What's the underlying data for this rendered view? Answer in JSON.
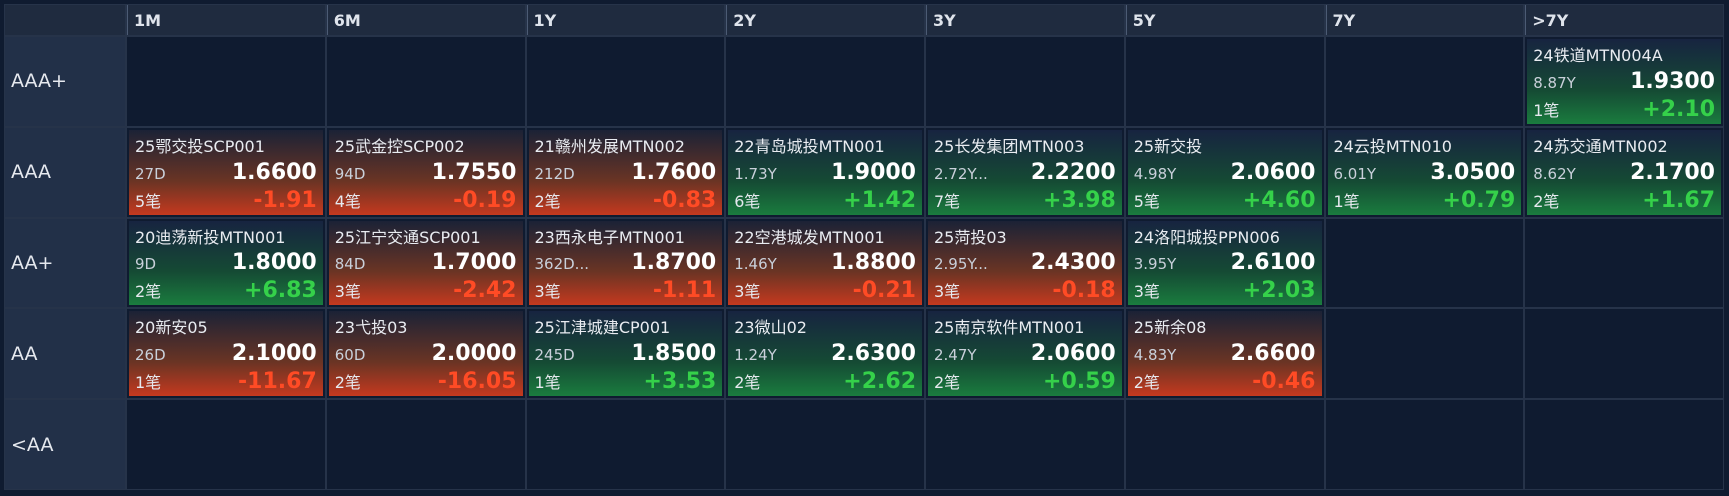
{
  "columns": [
    "1M",
    "6M",
    "1Y",
    "2Y",
    "3Y",
    "5Y",
    "7Y",
    ">7Y"
  ],
  "rows": [
    {
      "label": "AAA+",
      "cells": [
        null,
        null,
        null,
        null,
        null,
        null,
        null,
        {
          "name": "24铁道MTN004A",
          "term": "8.87Y",
          "price": "1.9300",
          "count": "1笔",
          "change": "+2.10",
          "dir": "up"
        }
      ]
    },
    {
      "label": "AAA",
      "cells": [
        {
          "name": "25鄂交投SCP001",
          "term": "27D",
          "price": "1.6600",
          "count": "5笔",
          "change": "-1.91",
          "dir": "down"
        },
        {
          "name": "25武金控SCP002",
          "term": "94D",
          "price": "1.7550",
          "count": "4笔",
          "change": "-0.19",
          "dir": "down"
        },
        {
          "name": "21赣州发展MTN002",
          "term": "212D",
          "price": "1.7600",
          "count": "2笔",
          "change": "-0.83",
          "dir": "down"
        },
        {
          "name": "22青岛城投MTN001",
          "term": "1.73Y",
          "price": "1.9000",
          "count": "6笔",
          "change": "+1.42",
          "dir": "up"
        },
        {
          "name": "25长发集团MTN003",
          "term": "2.72Y...",
          "price": "2.2200",
          "count": "7笔",
          "change": "+3.98",
          "dir": "up"
        },
        {
          "name": "25新交投",
          "term": "4.98Y",
          "price": "2.0600",
          "count": "5笔",
          "change": "+4.60",
          "dir": "up"
        },
        {
          "name": "24云投MTN010",
          "term": "6.01Y",
          "price": "3.0500",
          "count": "1笔",
          "change": "+0.79",
          "dir": "up"
        },
        {
          "name": "24苏交通MTN002",
          "term": "8.62Y",
          "price": "2.1700",
          "count": "2笔",
          "change": "+1.67",
          "dir": "up"
        }
      ]
    },
    {
      "label": "AA+",
      "cells": [
        {
          "name": "20迪荡新投MTN001",
          "term": "9D",
          "price": "1.8000",
          "count": "2笔",
          "change": "+6.83",
          "dir": "up"
        },
        {
          "name": "25江宁交通SCP001",
          "term": "84D",
          "price": "1.7000",
          "count": "3笔",
          "change": "-2.42",
          "dir": "down"
        },
        {
          "name": "23西永电子MTN001",
          "term": "362D...",
          "price": "1.8700",
          "count": "3笔",
          "change": "-1.11",
          "dir": "down"
        },
        {
          "name": "22空港城发MTN001",
          "term": "1.46Y",
          "price": "1.8800",
          "count": "3笔",
          "change": "-0.21",
          "dir": "down"
        },
        {
          "name": "25菏投03",
          "term": "2.95Y...",
          "price": "2.4300",
          "count": "3笔",
          "change": "-0.18",
          "dir": "down"
        },
        {
          "name": "24洛阳城投PPN006",
          "term": "3.95Y",
          "price": "2.6100",
          "count": "3笔",
          "change": "+2.03",
          "dir": "up"
        },
        null,
        null
      ]
    },
    {
      "label": "AA",
      "cells": [
        {
          "name": "20新安05",
          "term": "26D",
          "price": "2.1000",
          "count": "1笔",
          "change": "-11.67",
          "dir": "down"
        },
        {
          "name": "23弋投03",
          "term": "60D",
          "price": "2.0000",
          "count": "2笔",
          "change": "-16.05",
          "dir": "down"
        },
        {
          "name": "25江津城建CP001",
          "term": "245D",
          "price": "1.8500",
          "count": "1笔",
          "change": "+3.53",
          "dir": "up"
        },
        {
          "name": "23微山02",
          "term": "1.24Y",
          "price": "2.6300",
          "count": "2笔",
          "change": "+2.62",
          "dir": "up"
        },
        {
          "name": "25南京软件MTN001",
          "term": "2.47Y",
          "price": "2.0600",
          "count": "2笔",
          "change": "+0.59",
          "dir": "up"
        },
        {
          "name": "25新余08",
          "term": "4.83Y",
          "price": "2.6600",
          "count": "2笔",
          "change": "-0.46",
          "dir": "down"
        },
        null,
        null
      ]
    },
    {
      "label": "<AA",
      "cells": [
        null,
        null,
        null,
        null,
        null,
        null,
        null,
        null
      ]
    }
  ],
  "colors": {
    "up": "#35d14a",
    "down": "#ff4b25",
    "background": "#0f1b30",
    "header": "#1f2b3f"
  }
}
